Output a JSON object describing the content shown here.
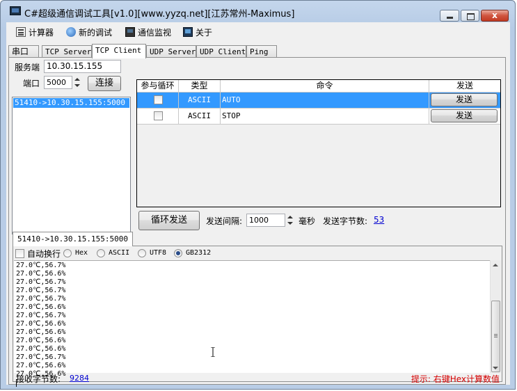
{
  "window": {
    "title": "C#超级通信调试工具[v1.0][www.yyzq.net][江苏常州-Maximus]",
    "close_glyph": "x"
  },
  "menu": [
    {
      "label": "计算器",
      "icon": "calculator-icon"
    },
    {
      "label": "新的调试",
      "icon": "network-icon"
    },
    {
      "label": "通信监视",
      "icon": "monitor-icon"
    },
    {
      "label": "关于",
      "icon": "about-icon"
    }
  ],
  "tabs": [
    "串口",
    "TCP Server",
    "TCP Client",
    "UDP Server",
    "UDP Client",
    "Ping"
  ],
  "active_tab": "TCP Client",
  "connection": {
    "server_label": "服务端",
    "server_value": "10.30.15.155",
    "port_label": "端口",
    "port_value": "5000",
    "connect_button": "连接",
    "list_items": [
      "51410->10.30.15.155:5000"
    ]
  },
  "command_table": {
    "headers": [
      "参与循环",
      "类型",
      "命令",
      "发送"
    ],
    "rows": [
      {
        "loop": false,
        "type": "ASCII",
        "command": "AUTO",
        "send": "发送",
        "selected": true
      },
      {
        "loop": false,
        "type": "ASCII",
        "command": "STOP",
        "send": "发送",
        "selected": false
      }
    ]
  },
  "send_controls": {
    "loop_send_button": "循环发送",
    "interval_label": "发送间隔:",
    "interval_value": "1000",
    "interval_unit": "毫秒",
    "bytes_label": "发送字节数:",
    "bytes_value": "53"
  },
  "receive": {
    "tab_label": "51410->10.30.15.155:5000",
    "auto_wrap_label": "自动换行",
    "encodings": [
      "Hex",
      "ASCII",
      "UTF8",
      "GB2312"
    ],
    "selected_encoding": "GB2312",
    "lines": [
      "27.0℃,56.7%",
      "27.0℃,56.6%",
      "27.0℃,56.7%",
      "27.0℃,56.7%",
      "27.0℃,56.7%",
      "27.0℃,56.6%",
      "27.0℃,56.7%",
      "27.0℃,56.6%",
      "27.0℃,56.6%",
      "27.0℃,56.6%",
      "27.0℃,56.6%",
      "27.0℃,56.7%",
      "27.0℃,56.6%",
      "27.0℃,56.6%"
    ],
    "bytes_label": "接收字节数:",
    "bytes_value": "9284",
    "hint": "提示: 右键Hex计算数值",
    "hint_color": "#d40000"
  }
}
